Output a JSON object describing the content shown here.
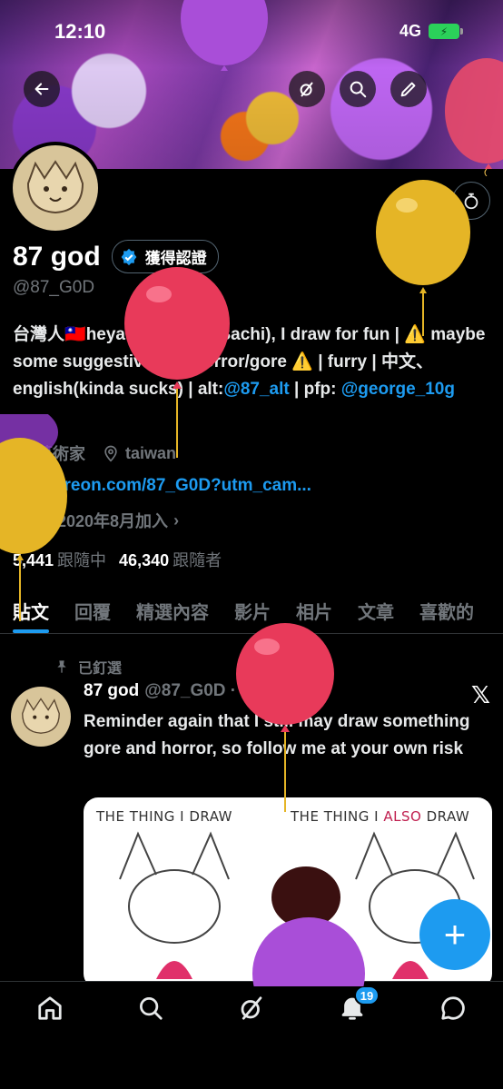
{
  "status_bar": {
    "time": "12:10",
    "network": "4G"
  },
  "profile": {
    "display_name": "87 god",
    "verified_label": "獲得認證",
    "handle": "@87_G0D",
    "bio_parts": {
      "p1": "台灣人",
      "p2": "heya call me 87(Bachi), I draw for fun | ",
      "p3": " maybe some suggestive and horror/gore ",
      "p4": " | furry | 中文、english(kinda sucks) | alt:",
      "alt_link": "@87_alt",
      "p5": " | pfp: ",
      "pfp_link": "@george_10g"
    },
    "profession": "藝術家",
    "location": "taiwan",
    "website": "patreon.com/87_G0D?utm_cam...",
    "joined": "於 2020年8月加入",
    "following_count": "5,441",
    "following_label": "跟隨中",
    "followers_count": "46,340",
    "followers_label": "跟隨者"
  },
  "tabs": [
    "貼文",
    "回覆",
    "精選內容",
    "影片",
    "相片",
    "文章",
    "喜歡的"
  ],
  "pinned_post": {
    "pinned_label": "已釘選",
    "name": "87 god",
    "handle_date": "@87_G0D · 2025/9/14",
    "text": "Reminder again that I still may draw something gore and horror, so follow me at your own risk",
    "media_caption_left": "THE THING I DRAW",
    "media_caption_right_a": "THE THING I ",
    "media_caption_right_b": "ALSO",
    "media_caption_right_c": " DRAW"
  },
  "notifications_badge": "19",
  "icons": [
    "back-arrow-icon",
    "grok-icon",
    "search-icon",
    "edit-icon",
    "more-icon",
    "verified-icon",
    "briefcase-icon",
    "location-icon",
    "link-icon",
    "calendar-icon",
    "pin-icon",
    "x-logo-icon",
    "compose-icon",
    "home-icon",
    "search-nav-icon",
    "grok-nav-icon",
    "bell-icon",
    "messages-icon"
  ],
  "colors": {
    "accent": "#1d9bf0",
    "muted": "#71767b",
    "background": "#000000"
  }
}
